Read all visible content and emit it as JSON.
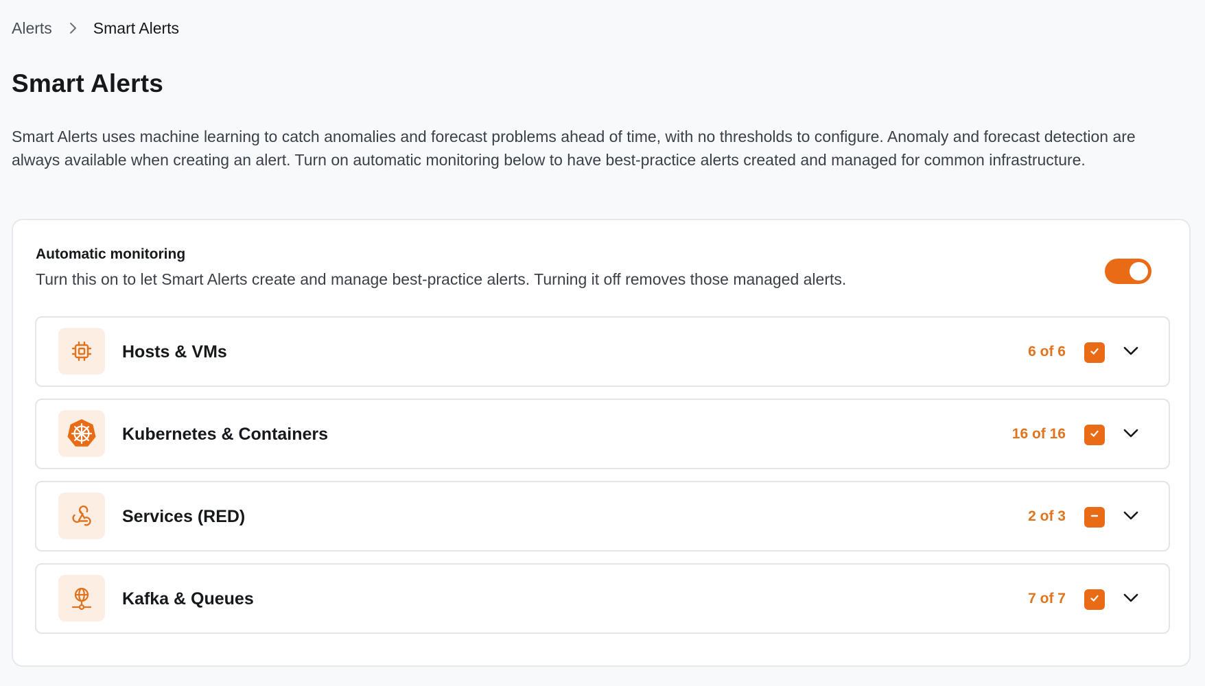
{
  "breadcrumb": {
    "parent": "Alerts",
    "current": "Smart Alerts"
  },
  "page": {
    "title": "Smart Alerts",
    "description": "Smart Alerts uses machine learning to catch anomalies and forecast problems ahead of time, with no thresholds to configure. Anomaly and forecast detection are always available when creating an alert. Turn on automatic monitoring below to have best-practice alerts created and managed for common infrastructure."
  },
  "automatic_monitoring": {
    "title": "Automatic monitoring",
    "description": "Turn this on to let Smart Alerts create and manage best-practice alerts. Turning it off removes those managed alerts.",
    "enabled": true
  },
  "groups": [
    {
      "name": "Hosts & VMs",
      "count": "6 of 6",
      "icon": "cpu-chip-icon",
      "state": "checked"
    },
    {
      "name": "Kubernetes & Containers",
      "count": "16 of 16",
      "icon": "kubernetes-helm-icon",
      "state": "checked"
    },
    {
      "name": "Services (RED)",
      "count": "2 of 3",
      "icon": "webhook-icon",
      "state": "indeterminate"
    },
    {
      "name": "Kafka & Queues",
      "count": "7 of 7",
      "icon": "network-globe-icon",
      "state": "checked"
    }
  ],
  "colors": {
    "accent": "#ea6b16",
    "count_text": "#e0731e",
    "icon_bg": "#fdeee4",
    "page_bg": "#f8f9fa"
  }
}
